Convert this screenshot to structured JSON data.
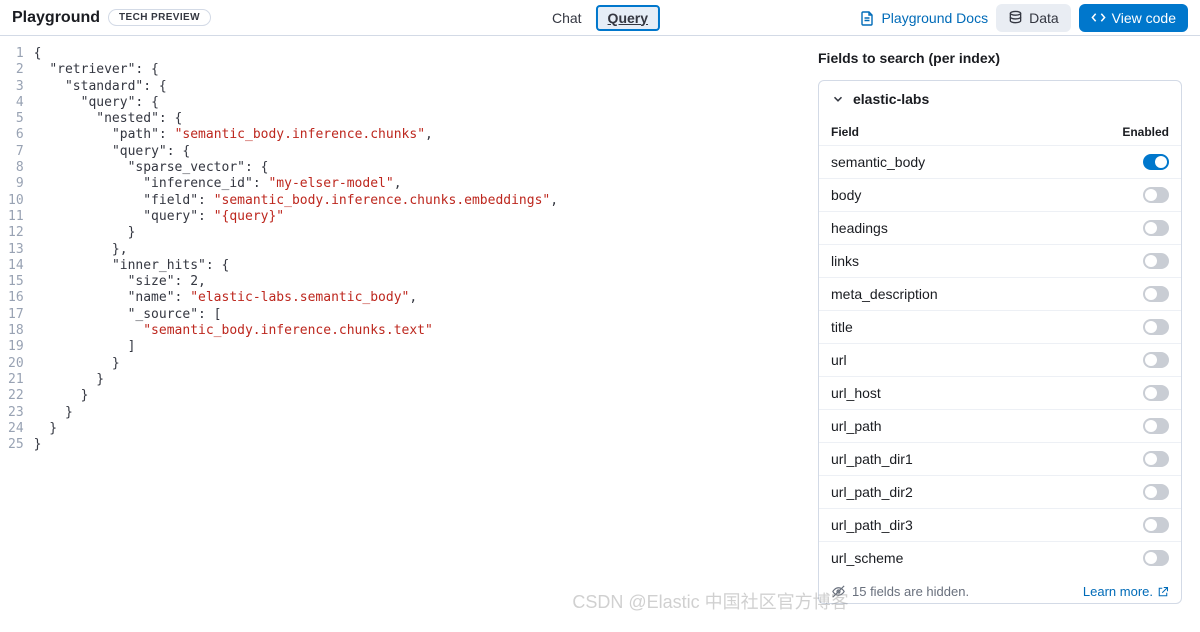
{
  "header": {
    "title": "Playground",
    "badge": "TECH PREVIEW",
    "tabs": {
      "chat": "Chat",
      "query": "Query"
    },
    "docs": "Playground Docs",
    "data_btn": "Data",
    "view_code_btn": "View code"
  },
  "code": {
    "lines": [
      [
        [
          "p",
          "{"
        ]
      ],
      [
        [
          "p",
          "  "
        ],
        [
          "k",
          "\"retriever\""
        ],
        [
          "p",
          ": {"
        ]
      ],
      [
        [
          "p",
          "    "
        ],
        [
          "k",
          "\"standard\""
        ],
        [
          "p",
          ": {"
        ]
      ],
      [
        [
          "p",
          "      "
        ],
        [
          "k",
          "\"query\""
        ],
        [
          "p",
          ": {"
        ]
      ],
      [
        [
          "p",
          "        "
        ],
        [
          "k",
          "\"nested\""
        ],
        [
          "p",
          ": {"
        ]
      ],
      [
        [
          "p",
          "          "
        ],
        [
          "k",
          "\"path\""
        ],
        [
          "p",
          ": "
        ],
        [
          "s",
          "\"semantic_body.inference.chunks\""
        ],
        [
          "p",
          ","
        ]
      ],
      [
        [
          "p",
          "          "
        ],
        [
          "k",
          "\"query\""
        ],
        [
          "p",
          ": {"
        ]
      ],
      [
        [
          "p",
          "            "
        ],
        [
          "k",
          "\"sparse_vector\""
        ],
        [
          "p",
          ": {"
        ]
      ],
      [
        [
          "p",
          "              "
        ],
        [
          "k",
          "\"inference_id\""
        ],
        [
          "p",
          ": "
        ],
        [
          "s",
          "\"my-elser-model\""
        ],
        [
          "p",
          ","
        ]
      ],
      [
        [
          "p",
          "              "
        ],
        [
          "k",
          "\"field\""
        ],
        [
          "p",
          ": "
        ],
        [
          "s",
          "\"semantic_body.inference.chunks.embeddings\""
        ],
        [
          "p",
          ","
        ]
      ],
      [
        [
          "p",
          "              "
        ],
        [
          "k",
          "\"query\""
        ],
        [
          "p",
          ": "
        ],
        [
          "s",
          "\"{query}\""
        ]
      ],
      [
        [
          "p",
          "            }"
        ]
      ],
      [
        [
          "p",
          "          },"
        ]
      ],
      [
        [
          "p",
          "          "
        ],
        [
          "k",
          "\"inner_hits\""
        ],
        [
          "p",
          ": {"
        ]
      ],
      [
        [
          "p",
          "            "
        ],
        [
          "k",
          "\"size\""
        ],
        [
          "p",
          ": 2,"
        ]
      ],
      [
        [
          "p",
          "            "
        ],
        [
          "k",
          "\"name\""
        ],
        [
          "p",
          ": "
        ],
        [
          "s",
          "\"elastic-labs.semantic_body\""
        ],
        [
          "p",
          ","
        ]
      ],
      [
        [
          "p",
          "            "
        ],
        [
          "k",
          "\"_source\""
        ],
        [
          "p",
          ": ["
        ]
      ],
      [
        [
          "p",
          "              "
        ],
        [
          "s",
          "\"semantic_body.inference.chunks.text\""
        ]
      ],
      [
        [
          "p",
          "            ]"
        ]
      ],
      [
        [
          "p",
          "          }"
        ]
      ],
      [
        [
          "p",
          "        }"
        ]
      ],
      [
        [
          "p",
          "      }"
        ]
      ],
      [
        [
          "p",
          "    }"
        ]
      ],
      [
        [
          "p",
          "  }"
        ]
      ],
      [
        [
          "p",
          "}"
        ]
      ]
    ]
  },
  "panel": {
    "title": "Fields to search (per index)",
    "index_name": "elastic-labs",
    "col_field": "Field",
    "col_enabled": "Enabled",
    "fields": [
      {
        "name": "semantic_body",
        "enabled": true
      },
      {
        "name": "body",
        "enabled": false
      },
      {
        "name": "headings",
        "enabled": false
      },
      {
        "name": "links",
        "enabled": false
      },
      {
        "name": "meta_description",
        "enabled": false
      },
      {
        "name": "title",
        "enabled": false
      },
      {
        "name": "url",
        "enabled": false
      },
      {
        "name": "url_host",
        "enabled": false
      },
      {
        "name": "url_path",
        "enabled": false
      },
      {
        "name": "url_path_dir1",
        "enabled": false
      },
      {
        "name": "url_path_dir2",
        "enabled": false
      },
      {
        "name": "url_path_dir3",
        "enabled": false
      },
      {
        "name": "url_scheme",
        "enabled": false
      }
    ],
    "hidden_count_text": "15 fields are hidden.",
    "learn_more": "Learn more."
  },
  "watermark": "CSDN @Elastic 中国社区官方博客"
}
